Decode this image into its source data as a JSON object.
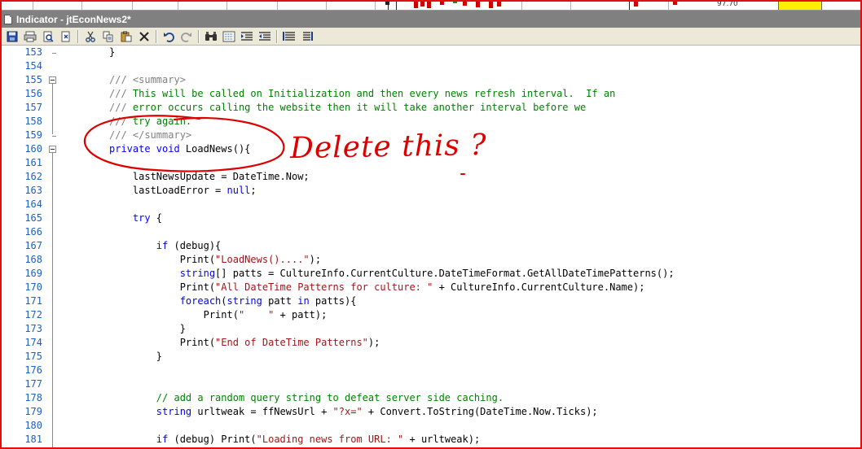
{
  "window": {
    "title": "Indicator - jtEconNews2*"
  },
  "chart_strip": {
    "price_label": "97.70",
    "highlight_color": "#ffee00"
  },
  "toolbar": {
    "buttons": [
      {
        "name": "save-icon"
      },
      {
        "name": "print-icon"
      },
      {
        "name": "print-preview-icon"
      },
      {
        "name": "page-setup-icon"
      },
      {
        "name": "cut-icon"
      },
      {
        "name": "copy-icon"
      },
      {
        "name": "paste-icon"
      },
      {
        "name": "delete-icon"
      },
      {
        "name": "undo-icon"
      },
      {
        "name": "redo-icon"
      },
      {
        "name": "find-icon"
      },
      {
        "name": "find-replace-icon"
      },
      {
        "name": "indent-icon"
      },
      {
        "name": "outdent-icon"
      },
      {
        "name": "comment-icon"
      },
      {
        "name": "uncomment-icon"
      }
    ]
  },
  "editor": {
    "lines": [
      {
        "n": "153",
        "segments": [
          [
            "",
            "}"
          ]
        ]
      },
      {
        "n": "154",
        "segments": []
      },
      {
        "n": "155",
        "segments": [
          [
            "doc",
            "/// <summary>"
          ]
        ]
      },
      {
        "n": "156",
        "segments": [
          [
            "doc",
            "/// "
          ],
          [
            "cmt",
            "This will be called on Initialization and then every news refresh interval.  If an"
          ]
        ]
      },
      {
        "n": "157",
        "segments": [
          [
            "doc",
            "/// "
          ],
          [
            "cmt",
            "error occurs calling the website then it will take another interval before we"
          ]
        ]
      },
      {
        "n": "158",
        "segments": [
          [
            "doc",
            "/// "
          ],
          [
            "cmt",
            "try again."
          ]
        ]
      },
      {
        "n": "159",
        "segments": [
          [
            "doc",
            "/// </summary>"
          ]
        ]
      },
      {
        "n": "160",
        "segments": [
          [
            "kw",
            "private void "
          ],
          [
            "",
            "LoadNews(){"
          ]
        ]
      },
      {
        "n": "161",
        "segments": []
      },
      {
        "n": "162",
        "segments": [
          [
            "",
            "    lastNewsUpdate = DateTime.Now;"
          ]
        ]
      },
      {
        "n": "163",
        "segments": [
          [
            "",
            "    lastLoadError = "
          ],
          [
            "kw",
            "null"
          ],
          [
            "",
            ";"
          ]
        ]
      },
      {
        "n": "164",
        "segments": []
      },
      {
        "n": "165",
        "segments": [
          [
            "kw",
            "    try "
          ],
          [
            "",
            "{"
          ]
        ]
      },
      {
        "n": "166",
        "segments": []
      },
      {
        "n": "167",
        "segments": [
          [
            "kw",
            "        if "
          ],
          [
            "",
            "(debug){"
          ]
        ]
      },
      {
        "n": "168",
        "segments": [
          [
            "",
            "            Print("
          ],
          [
            "str",
            "\"LoadNews()....\""
          ],
          [
            "",
            ");"
          ]
        ]
      },
      {
        "n": "169",
        "segments": [
          [
            "kw",
            "            string"
          ],
          [
            "",
            "[] patts = CultureInfo.CurrentCulture.DateTimeFormat.GetAllDateTimePatterns();"
          ]
        ]
      },
      {
        "n": "170",
        "segments": [
          [
            "",
            "            Print("
          ],
          [
            "str",
            "\"All DateTime Patterns for culture: \""
          ],
          [
            "",
            " + CultureInfo.CurrentCulture.Name);"
          ]
        ]
      },
      {
        "n": "171",
        "segments": [
          [
            "kw",
            "            foreach"
          ],
          [
            "",
            "("
          ],
          [
            "kw",
            "string "
          ],
          [
            "",
            "patt "
          ],
          [
            "kw",
            "in "
          ],
          [
            "",
            "patts){"
          ]
        ]
      },
      {
        "n": "172",
        "segments": [
          [
            "",
            "                Print("
          ],
          [
            "str",
            "\"    \""
          ],
          [
            "",
            " + patt);"
          ]
        ]
      },
      {
        "n": "173",
        "segments": [
          [
            "",
            "            }"
          ]
        ]
      },
      {
        "n": "174",
        "segments": [
          [
            "",
            "            Print("
          ],
          [
            "str",
            "\"End of DateTime Patterns\""
          ],
          [
            "",
            ");"
          ]
        ]
      },
      {
        "n": "175",
        "segments": [
          [
            "",
            "        }"
          ]
        ]
      },
      {
        "n": "176",
        "segments": []
      },
      {
        "n": "177",
        "segments": []
      },
      {
        "n": "178",
        "segments": [
          [
            "cmt",
            "        // add a random query string to defeat server side caching."
          ]
        ]
      },
      {
        "n": "179",
        "segments": [
          [
            "kw",
            "        string "
          ],
          [
            "",
            "urltweak = ffNewsUrl + "
          ],
          [
            "str",
            "\"?x=\""
          ],
          [
            "",
            " + Convert.ToString(DateTime.Now.Ticks);"
          ]
        ]
      },
      {
        "n": "180",
        "segments": []
      },
      {
        "n": "181",
        "segments": [
          [
            "kw",
            "        if "
          ],
          [
            "",
            "(debug) Print("
          ],
          [
            "str",
            "\"Loading news from URL: \""
          ],
          [
            "",
            " + urltweak);"
          ]
        ]
      }
    ]
  },
  "annotation": {
    "text": "Delete this ?",
    "color": "#dd0000"
  }
}
